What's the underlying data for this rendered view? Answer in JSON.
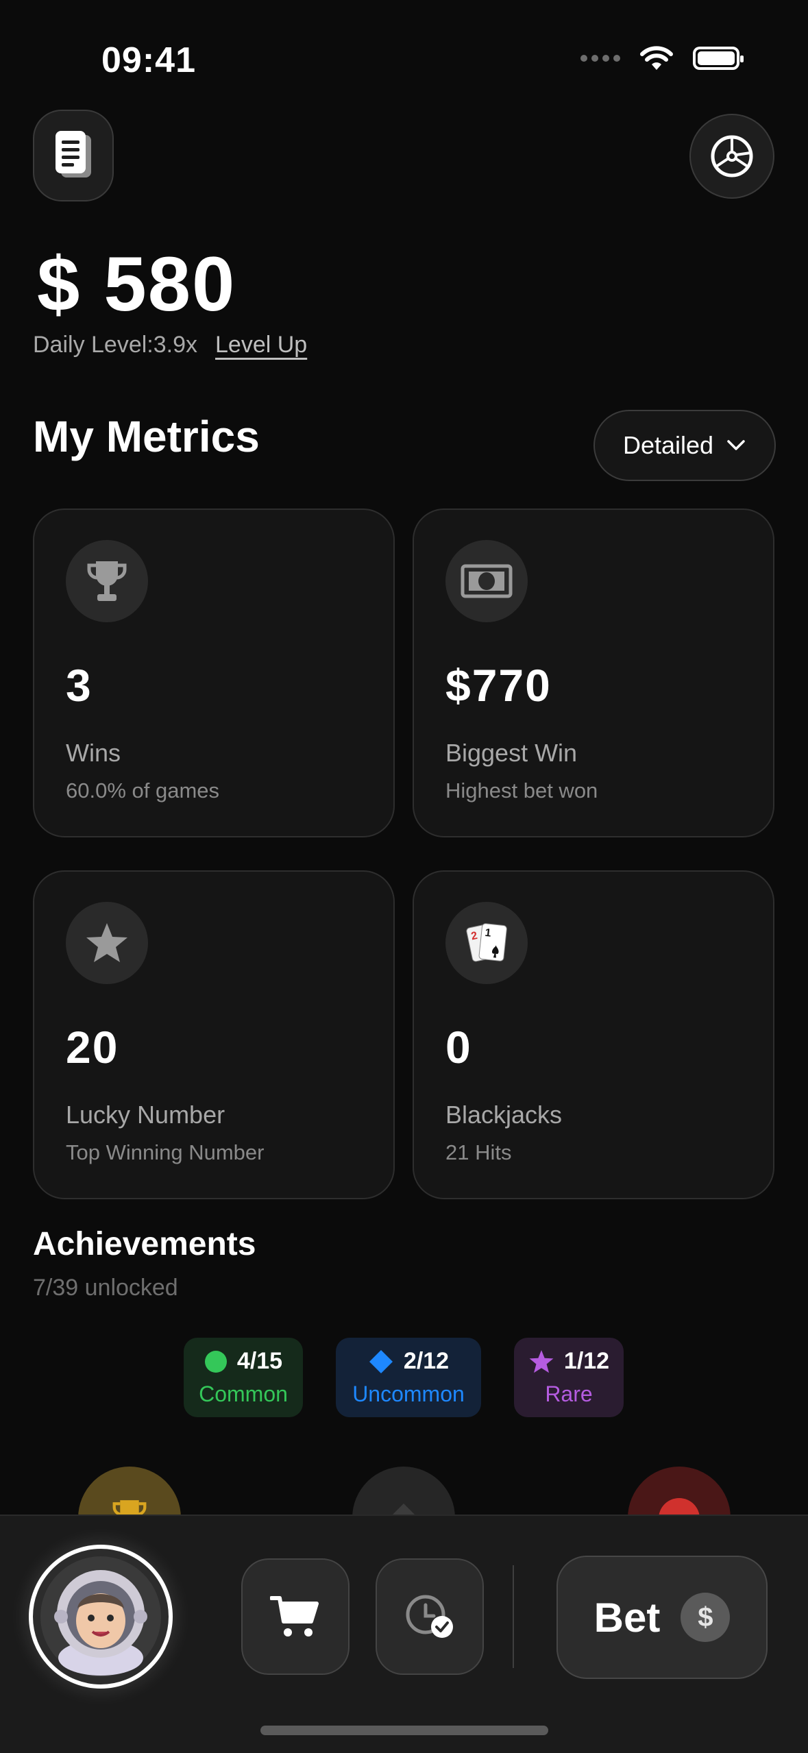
{
  "status_bar": {
    "time": "09:41"
  },
  "balance": {
    "amount": "$ 580",
    "daily_level": "Daily Level:3.9x",
    "level_up": "Level Up"
  },
  "metrics": {
    "title": "My Metrics",
    "view_mode": "Detailed",
    "cards": [
      {
        "icon": "trophy-icon",
        "value": "3",
        "label": "Wins",
        "sub": "60.0% of games"
      },
      {
        "icon": "banknote-icon",
        "value": "$770",
        "label": "Biggest Win",
        "sub": "Highest bet won"
      },
      {
        "icon": "star-icon",
        "value": "20",
        "label": "Lucky Number",
        "sub": "Top Winning Number"
      },
      {
        "icon": "playing-cards-icon",
        "value": "0",
        "label": "Blackjacks",
        "sub": "21 Hits"
      }
    ]
  },
  "achievements": {
    "title": "Achievements",
    "progress": "7/39 unlocked",
    "tiers": [
      {
        "count": "4/15",
        "name": "Common",
        "color": "#34c759"
      },
      {
        "count": "2/12",
        "name": "Uncommon",
        "color": "#1e88ff"
      },
      {
        "count": "1/12",
        "name": "Rare",
        "color": "#b55ce0"
      }
    ]
  },
  "bottom_bar": {
    "bet_label": "Bet",
    "coin_symbol": "$"
  }
}
